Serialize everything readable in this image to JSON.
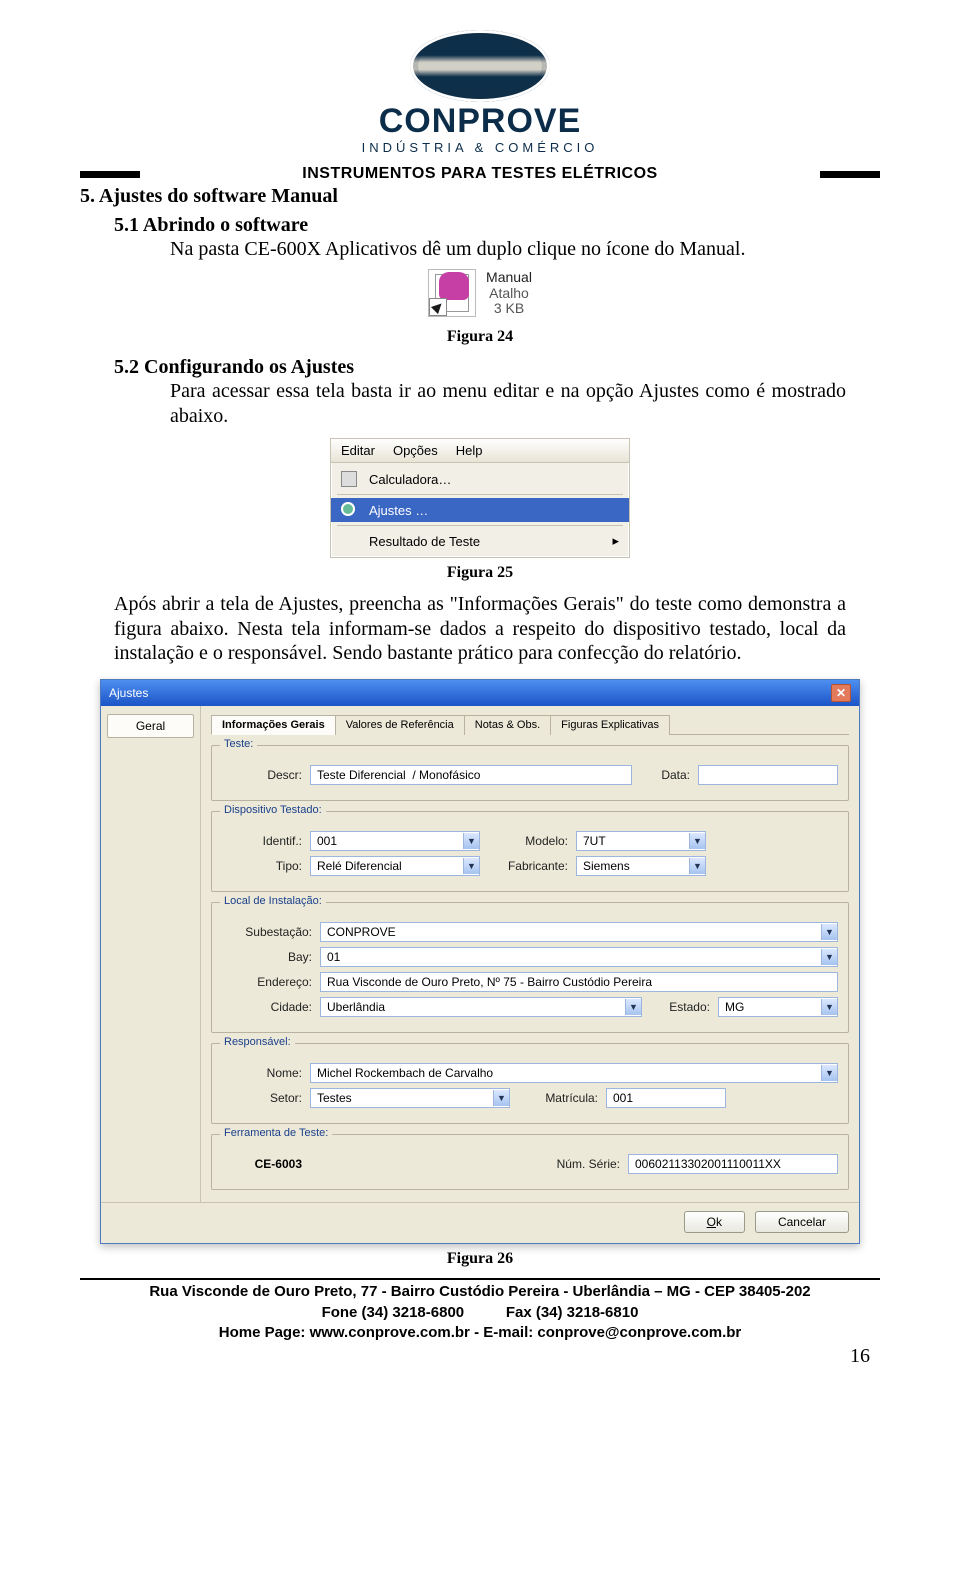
{
  "header": {
    "brand": "CONPROVE",
    "brand_sub": "INDÚSTRIA & COMÉRCIO",
    "subtitle": "INSTRUMENTOS PARA TESTES ELÉTRICOS"
  },
  "section": {
    "num_title": "5.  Ajustes do software Manual",
    "s51_title": "5.1 Abrindo o software",
    "s51_text": "Na pasta CE-600X Aplicativos dê um duplo clique no ícone do Manual.",
    "fig24_caption": "Figura 24",
    "shortcut": {
      "name": "Manual",
      "type": "Atalho",
      "size": "3 KB"
    },
    "s52_title": "5.2 Configurando os Ajustes",
    "s52_text": "Para acessar essa tela basta ir ao menu editar e na opção Ajustes como é mostrado abaixo.",
    "fig25_caption": "Figura 25",
    "menu": {
      "bar": {
        "editar": "Editar",
        "opcoes": "Opções",
        "help": "Help"
      },
      "items": {
        "calc": "Calculadora…",
        "ajustes": "Ajustes …",
        "resultado": "Resultado de Teste"
      },
      "chevron": "▸"
    },
    "p_after25": "Após abrir a tela de Ajustes, preencha as \"Informações Gerais\" do teste como demonstra a figura abaixo. Nesta tela informam-se dados a respeito do dispositivo testado, local da instalação e o responsável. Sendo bastante prático para confecção do relatório.",
    "fig26_caption": "Figura 26"
  },
  "dialog": {
    "title": "Ajustes",
    "side_btn": "Geral",
    "tabs": [
      "Informações Gerais",
      "Valores de Referência",
      "Notas & Obs.",
      "Figuras Explicativas"
    ],
    "groups": {
      "teste": {
        "legend": "Teste:",
        "descr_label": "Descr:",
        "descr_value": "Teste Diferencial  / Monofásico",
        "data_label": "Data:",
        "data_value": ""
      },
      "dispositivo": {
        "legend": "Dispositivo Testado:",
        "identif_label": "Identif.:",
        "identif_value": "001",
        "modelo_label": "Modelo:",
        "modelo_value": "7UT",
        "tipo_label": "Tipo:",
        "tipo_value": "Relé Diferencial",
        "fabricante_label": "Fabricante:",
        "fabricante_value": "Siemens"
      },
      "local": {
        "legend": "Local de Instalação:",
        "subestacao_label": "Subestação:",
        "subestacao_value": "CONPROVE",
        "bay_label": "Bay:",
        "bay_value": "01",
        "endereco_label": "Endereço:",
        "endereco_value": "Rua Visconde de Ouro Preto, Nº 75 - Bairro Custódio Pereira",
        "cidade_label": "Cidade:",
        "cidade_value": "Uberlândia",
        "estado_label": "Estado:",
        "estado_value": "MG"
      },
      "responsavel": {
        "legend": "Responsável:",
        "nome_label": "Nome:",
        "nome_value": "Michel Rockembach de Carvalho",
        "setor_label": "Setor:",
        "setor_value": "Testes",
        "matricula_label": "Matrícula:",
        "matricula_value": "001"
      },
      "ferramenta": {
        "legend": "Ferramenta de Teste:",
        "modelo_label": "",
        "modelo_value": "CE-6003",
        "serie_label": "Núm. Série:",
        "serie_value": "00602113302001110011XX"
      }
    },
    "buttons": {
      "ok": "Ok",
      "cancel": "Cancelar"
    }
  },
  "footer": {
    "line1": "Rua Visconde de Ouro Preto, 77 -  Bairro Custódio Pereira - Uberlândia – MG -  CEP 38405-202",
    "line2_left": "Fone (34) 3218-6800",
    "line2_right": "Fax (34) 3218-6810",
    "line3": "Home Page: www.conprove.com.br    -    E-mail: conprove@conprove.com.br",
    "pagenum": "16"
  }
}
